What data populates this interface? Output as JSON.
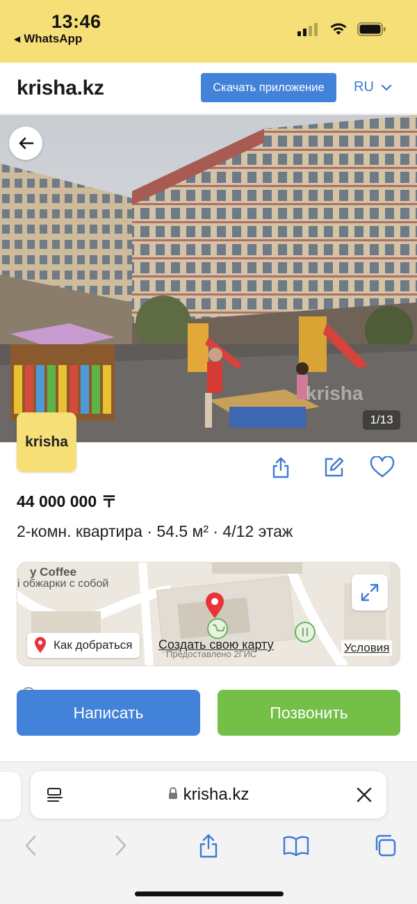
{
  "status_bar": {
    "time": "13:46",
    "back_app": "WhatsApp",
    "icons": [
      "cellular-signal-icon",
      "wifi-icon",
      "battery-icon"
    ]
  },
  "header": {
    "logo": "krisha.kz",
    "download_button": "Скачать приложение",
    "language": "RU"
  },
  "listing": {
    "photo_counter": "1/13",
    "watermark": "krisha",
    "agency_badge": "krisha",
    "price": "44 000 000 〒",
    "summary": "2-комн. квартира · 54.5 м² · 4/12 этаж",
    "actions": [
      "share-icon",
      "edit-icon",
      "favorite-heart-icon"
    ]
  },
  "map": {
    "label_top": "y Coffee",
    "label_top2": "і обжарки с собой",
    "route_button": "Как добраться",
    "create_map_link": "Создать свою карту",
    "attribution": "Предоставлено 2ГИС",
    "conditions_link": "Условия",
    "pin_color": "#e8323c"
  },
  "contact": {
    "write_button": "Написать",
    "call_button": "Позвонить",
    "write_color": "#4282d9",
    "call_color": "#73bf48"
  },
  "safari": {
    "url": "krisha.kz",
    "toolbar_icons": [
      "back-icon",
      "forward-icon",
      "share-icon",
      "bookmarks-icon",
      "tabs-icon"
    ]
  },
  "colors": {
    "brand_yellow": "#f7df78",
    "accent_blue": "#3d7ad5"
  }
}
